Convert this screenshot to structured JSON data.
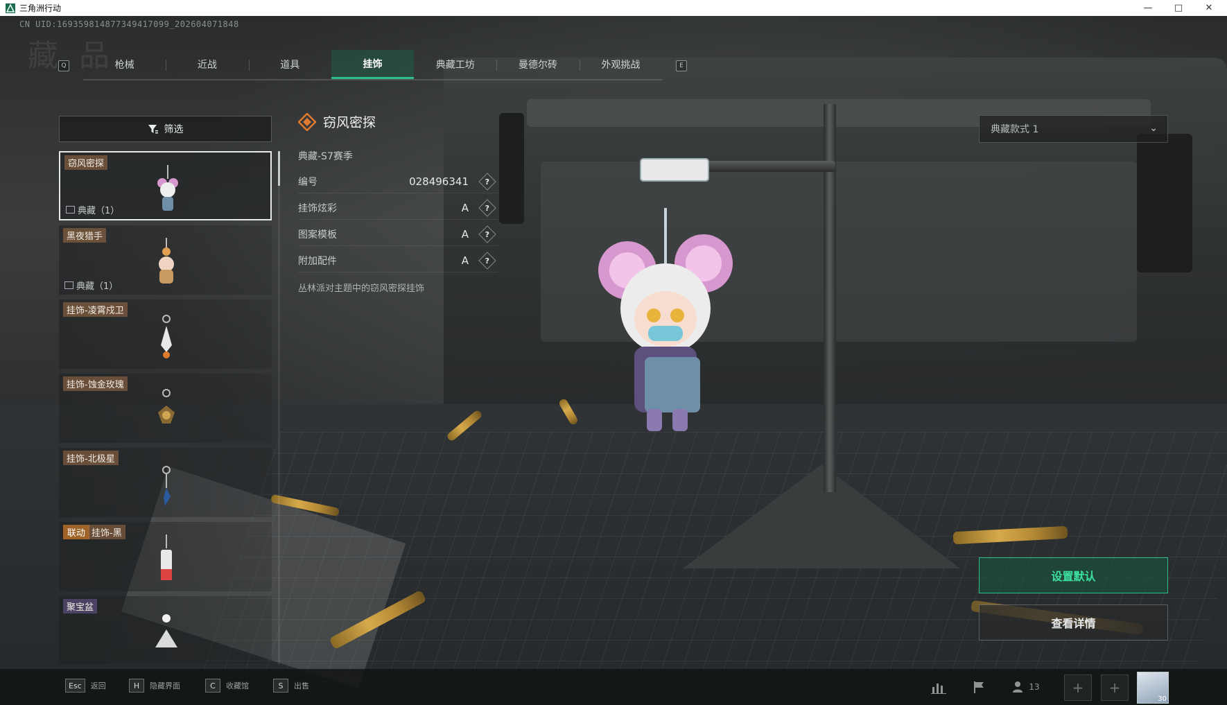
{
  "window": {
    "title": "三角洲行动"
  },
  "uid": "CN UID:1693598148773494170​99_20260407184​8",
  "watermark": "藏 品",
  "tabs": {
    "prev_key": "Q",
    "next_key": "E",
    "items": [
      {
        "label": "枪械",
        "active": false
      },
      {
        "label": "近战",
        "active": false
      },
      {
        "label": "道具",
        "active": false
      },
      {
        "label": "挂饰",
        "active": true
      },
      {
        "label": "典藏工坊",
        "active": false
      },
      {
        "label": "曼德尔砖",
        "active": false
      },
      {
        "label": "外观挑战",
        "active": false
      }
    ]
  },
  "filter": {
    "label": "筛选"
  },
  "list": {
    "items": [
      {
        "name": "窃风密探",
        "collection": "典藏（1）",
        "selected": true
      },
      {
        "name": "黑夜猎手",
        "collection": "典藏（1）",
        "selected": false
      },
      {
        "name": "挂饰-凌霄戍卫",
        "collection": "",
        "selected": false
      },
      {
        "name": "挂饰-蚀金玫瑰",
        "collection": "",
        "selected": false
      },
      {
        "name": "挂饰-北极星",
        "collection": "",
        "selected": false
      },
      {
        "tag": "联动",
        "name": "挂饰-黑",
        "collection": "",
        "selected": false
      },
      {
        "name": "聚宝盆",
        "collection": "",
        "selected": false
      }
    ]
  },
  "info": {
    "title": "窃风密探",
    "season": "典藏-S7赛季",
    "rows": [
      {
        "label": "编号",
        "value": "028496341"
      },
      {
        "label": "挂饰炫彩",
        "value": "A"
      },
      {
        "label": "图案模板",
        "value": "A"
      },
      {
        "label": "附加配件",
        "value": "A"
      }
    ],
    "help_glyph": "?",
    "description": "丛林派对主题中的窃风密探挂饰"
  },
  "style_select": {
    "value": "典藏款式 1"
  },
  "actions": {
    "set_default": "设置默认",
    "view_details": "查看详情"
  },
  "bottom_hints": [
    {
      "key": "Esc",
      "label": "返回"
    },
    {
      "key": "H",
      "label": "隐藏界面"
    },
    {
      "key": "C",
      "label": "收藏馆"
    },
    {
      "key": "S",
      "label": "出售"
    }
  ],
  "hud": {
    "friends_count": "13",
    "avatar_level": "30"
  },
  "colors": {
    "accent": "#2dbd8a",
    "tab_active_bg": "#177257",
    "name_tag": "#a06e46",
    "collab_tag": "#c87828"
  }
}
